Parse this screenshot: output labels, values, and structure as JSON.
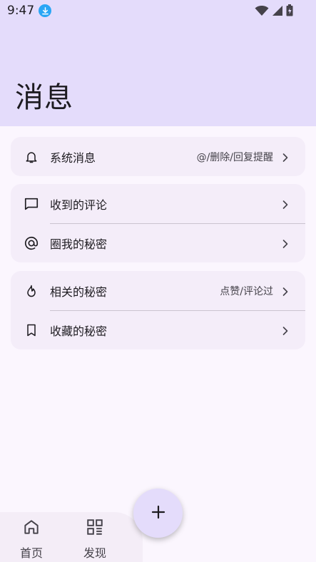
{
  "status_bar": {
    "time": "9:47",
    "icons": [
      "download-icon",
      "wifi-icon",
      "signal-icon",
      "battery-icon"
    ]
  },
  "header": {
    "title": "消息",
    "background": "#e4dcfb"
  },
  "groups": [
    {
      "items": [
        {
          "icon": "bell-icon",
          "label": "系统消息",
          "hint": "@/删除/回复提醒"
        }
      ]
    },
    {
      "items": [
        {
          "icon": "comment-icon",
          "label": "收到的评论",
          "hint": ""
        },
        {
          "icon": "at-icon",
          "label": "圈我的秘密",
          "hint": ""
        }
      ]
    },
    {
      "items": [
        {
          "icon": "flame-icon",
          "label": "相关的秘密",
          "hint": "点赞/评论过"
        },
        {
          "icon": "bookmark-icon",
          "label": "收藏的秘密",
          "hint": ""
        }
      ]
    }
  ],
  "bottom_nav": {
    "items": [
      {
        "icon": "home-icon",
        "label": "首页"
      },
      {
        "icon": "grid-icon",
        "label": "发现"
      }
    ]
  },
  "fab": {
    "icon": "plus-icon"
  }
}
